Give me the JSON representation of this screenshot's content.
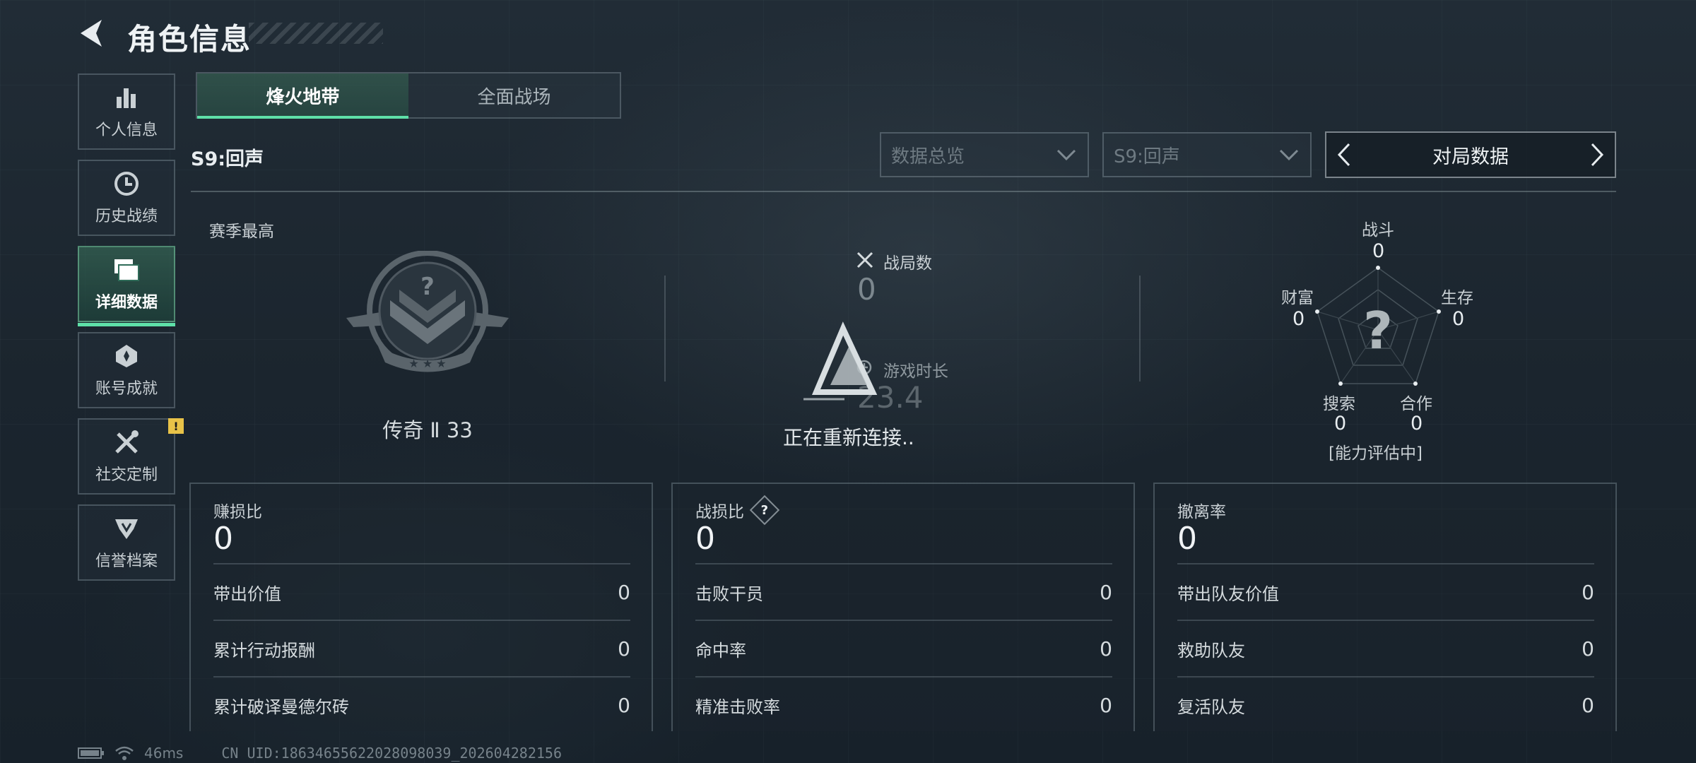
{
  "header": {
    "title": "角色信息"
  },
  "sidebar": {
    "items": [
      {
        "label": "个人信息",
        "icon": "bar-chart-icon"
      },
      {
        "label": "历史战绩",
        "icon": "history-clock-icon"
      },
      {
        "label": "详细数据",
        "icon": "folder-icon",
        "active": true
      },
      {
        "label": "账号成就",
        "icon": "medal-icon"
      },
      {
        "label": "社交定制",
        "icon": "wrench-screwdriver-icon",
        "badge": "!"
      },
      {
        "label": "信誉档案",
        "icon": "shield-emblem-icon"
      }
    ]
  },
  "tabs": [
    {
      "label": "烽火地带",
      "active": true
    },
    {
      "label": "全面战场"
    }
  ],
  "season_label": "S9:回声",
  "filters": {
    "dropdown1": "数据总览",
    "dropdown2": "S9:回声",
    "switcher": "对局数据"
  },
  "rank": {
    "caption": "赛季最高",
    "text": "传奇 Ⅱ 33",
    "emblem_mark": "?"
  },
  "middle": {
    "matches_label": "战局数",
    "matches_value": "0",
    "playtime_label": "游戏时长",
    "playtime_value": "23.4",
    "reconnect_text": "正在重新连接.."
  },
  "radar": {
    "center_mark": "?",
    "axes": [
      {
        "label": "战斗",
        "value": "0"
      },
      {
        "label": "生存",
        "value": "0"
      },
      {
        "label": "合作",
        "value": "0"
      },
      {
        "label": "搜索",
        "value": "0"
      },
      {
        "label": "财富",
        "value": "0"
      }
    ],
    "footer": "[能力评估中]"
  },
  "cards": [
    {
      "title": "赚损比",
      "value": "0",
      "rows": [
        {
          "label": "带出价值",
          "value": "0"
        },
        {
          "label": "累计行动报酬",
          "value": "0"
        },
        {
          "label": "累计破译曼德尔砖",
          "value": "0"
        }
      ]
    },
    {
      "title": "战损比",
      "value": "0",
      "help": "?",
      "rows": [
        {
          "label": "击败干员",
          "value": "0"
        },
        {
          "label": "命中率",
          "value": "0"
        },
        {
          "label": "精准击败率",
          "value": "0"
        }
      ]
    },
    {
      "title": "撤离率",
      "value": "0",
      "rows": [
        {
          "label": "带出队友价值",
          "value": "0"
        },
        {
          "label": "救助队友",
          "value": "0"
        },
        {
          "label": "复活队友",
          "value": "0"
        }
      ]
    }
  ],
  "footer": {
    "ping": "46ms",
    "uid": "CN UID:18634655622028098039_202604282156"
  },
  "colors": {
    "accent": "#5ee0a8",
    "badge": "#e8c248",
    "background": "#1d2730"
  }
}
